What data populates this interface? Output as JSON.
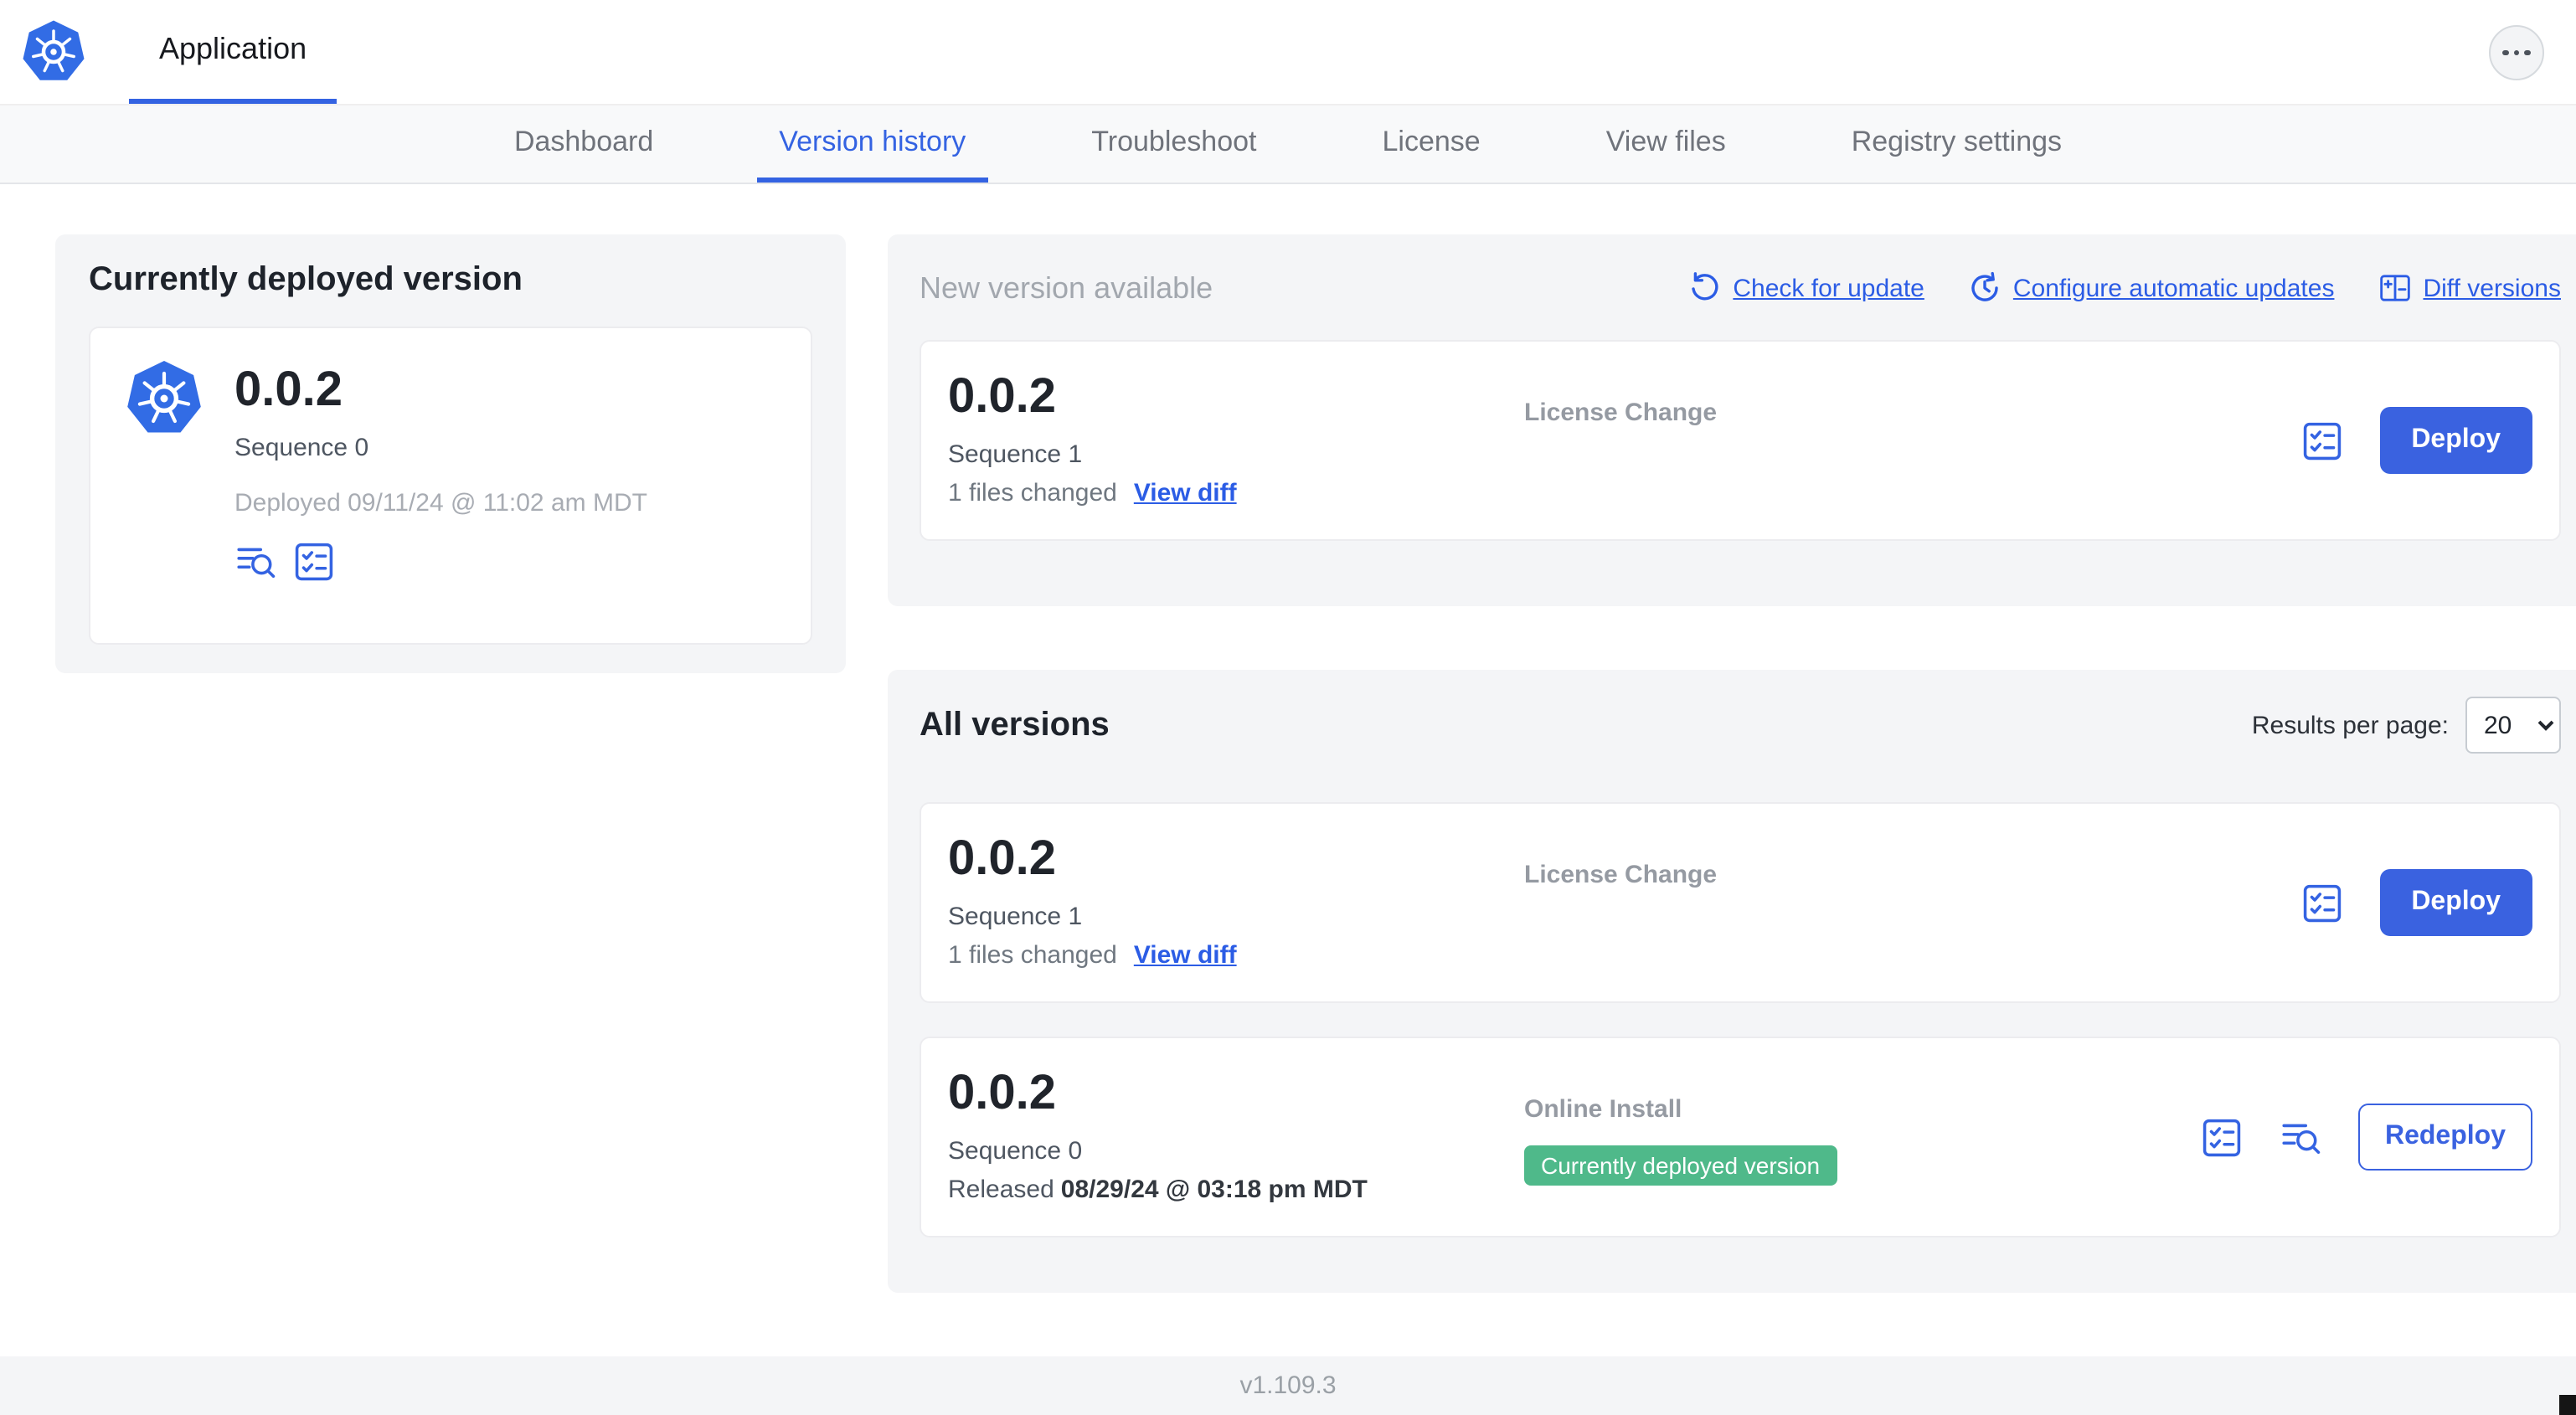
{
  "header": {
    "app_tab": "Application"
  },
  "nav": {
    "active_tab": "Version history",
    "tabs": [
      {
        "label": "Dashboard"
      },
      {
        "label": "Version history"
      },
      {
        "label": "Troubleshoot"
      },
      {
        "label": "License"
      },
      {
        "label": "View files"
      },
      {
        "label": "Registry settings"
      }
    ]
  },
  "currently_deployed": {
    "title": "Currently deployed version",
    "version": "0.0.2",
    "sequence": "Sequence 0",
    "deployed_at": "Deployed 09/11/24 @ 11:02 am MDT"
  },
  "new_version": {
    "title": "New version available",
    "check_for_update": "Check for update",
    "configure_automatic_updates": "Configure automatic updates",
    "diff_versions": "Diff versions",
    "card": {
      "version": "0.0.2",
      "sequence": "Sequence 1",
      "files_changed": "1 files changed",
      "view_diff": "View diff",
      "source": "License Change",
      "deploy": "Deploy"
    }
  },
  "all_versions": {
    "title": "All versions",
    "results_per_page_label": "Results per page:",
    "results_per_page": "20",
    "rows": [
      {
        "version": "0.0.2",
        "sequence": "Sequence 1",
        "files_changed": "1 files changed",
        "view_diff": "View diff",
        "source": "License Change",
        "action": "Deploy"
      },
      {
        "version": "0.0.2",
        "sequence": "Sequence 0",
        "released_prefix": "Released",
        "released_date": "08/29/24 @ 03:18 pm MDT",
        "source": "Online Install",
        "badge": "Currently deployed version",
        "action": "Redeploy"
      }
    ]
  },
  "footer": {
    "version": "v1.109.3"
  },
  "icons": {
    "kubernetes-logo": "heptagon-helm-wheel",
    "more-menu": "ellipsis-dots-circle",
    "check-for-update": "counterclockwise-arrow",
    "configure-automatic-updates": "clock-refresh",
    "diff-versions": "split-table-plus-minus",
    "release-notes": "checklist-square",
    "view-logs": "lines-with-magnifier"
  },
  "colors": {
    "accent_blue": "#3a62e0",
    "link_blue": "#2b5ce5",
    "kubernetes_blue": "#326CE5",
    "badge_green": "#4fb98a",
    "panel_gray": "#f4f5f7",
    "muted_text": "#9aa0a6"
  }
}
